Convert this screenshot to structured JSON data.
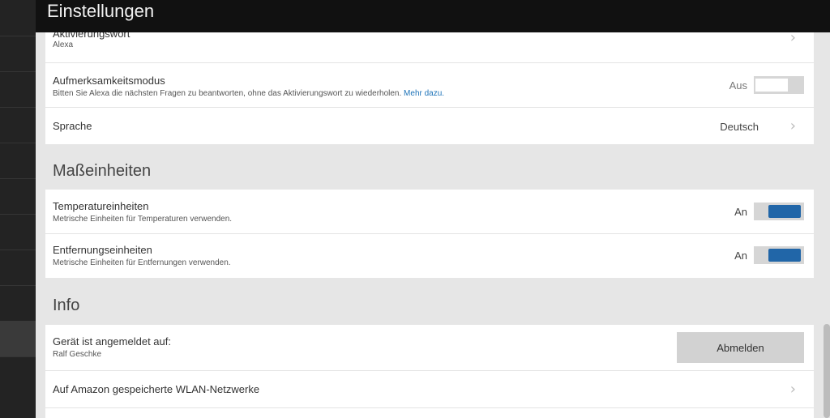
{
  "header": {
    "title": "Einstellungen"
  },
  "alexa": {
    "wake_word": {
      "label": "Aktivierungswort",
      "value": "Alexa"
    },
    "follow_up": {
      "label": "Aufmerksamkeitsmodus",
      "description": "Bitten Sie Alexa die nächsten Fragen zu beantworten, ohne das Aktivierungswort zu wiederholen.",
      "link": "Mehr dazu.",
      "state_label": "Aus",
      "enabled": false
    },
    "language": {
      "label": "Sprache",
      "value": "Deutsch"
    }
  },
  "units": {
    "section_title": "Maßeinheiten",
    "temperature": {
      "label": "Temperatureinheiten",
      "description": "Metrische Einheiten für Temperaturen verwenden.",
      "state_label": "An",
      "enabled": true
    },
    "distance": {
      "label": "Entfernungseinheiten",
      "description": "Metrische Einheiten für Entfernungen verwenden.",
      "state_label": "An",
      "enabled": true
    }
  },
  "info": {
    "section_title": "Info",
    "registered": {
      "label": "Gerät ist angemeldet auf:",
      "value": "Ralf Geschke",
      "button": "Abmelden"
    },
    "wifi": {
      "label": "Auf Amazon gespeicherte WLAN-Netzwerke"
    }
  },
  "icons": {
    "chevron": "chevron-right-icon"
  },
  "colors": {
    "toggle_on": "#2166a8",
    "link": "#1e73b8"
  }
}
